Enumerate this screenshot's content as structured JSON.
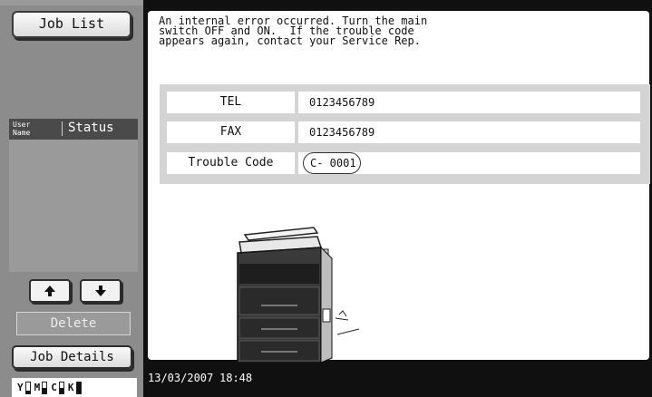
{
  "sidebar": {
    "job_list_label": "Job List",
    "header": {
      "user_name_label": "User\nName",
      "status_label": "Status"
    },
    "up_icon": "arrow-up-icon",
    "down_icon": "arrow-down-icon",
    "delete_label": "Delete",
    "job_details_label": "Job Details",
    "toner": [
      {
        "label": "Y",
        "level": 0.2
      },
      {
        "label": "M",
        "level": 0.5
      },
      {
        "label": "C",
        "level": 0.45
      },
      {
        "label": "K",
        "level": 1.0
      }
    ]
  },
  "main": {
    "message": "An internal error occurred. Turn the main\nswitch OFF and ON.  If the trouble code\nappears again, contact your Service Rep.",
    "info": [
      {
        "label": "TEL",
        "value": "0123456789"
      },
      {
        "label": "FAX",
        "value": "0123456789"
      },
      {
        "label": "Trouble Code",
        "value": "C- 0001"
      }
    ],
    "printer_icon": "copier-machine-icon"
  },
  "status_bar": {
    "date": "13/03/2007",
    "time": "18:48"
  },
  "colors": {
    "frame": "#101010",
    "sidebar": "#8c8c8c",
    "info_box": "#d4d4d4"
  }
}
